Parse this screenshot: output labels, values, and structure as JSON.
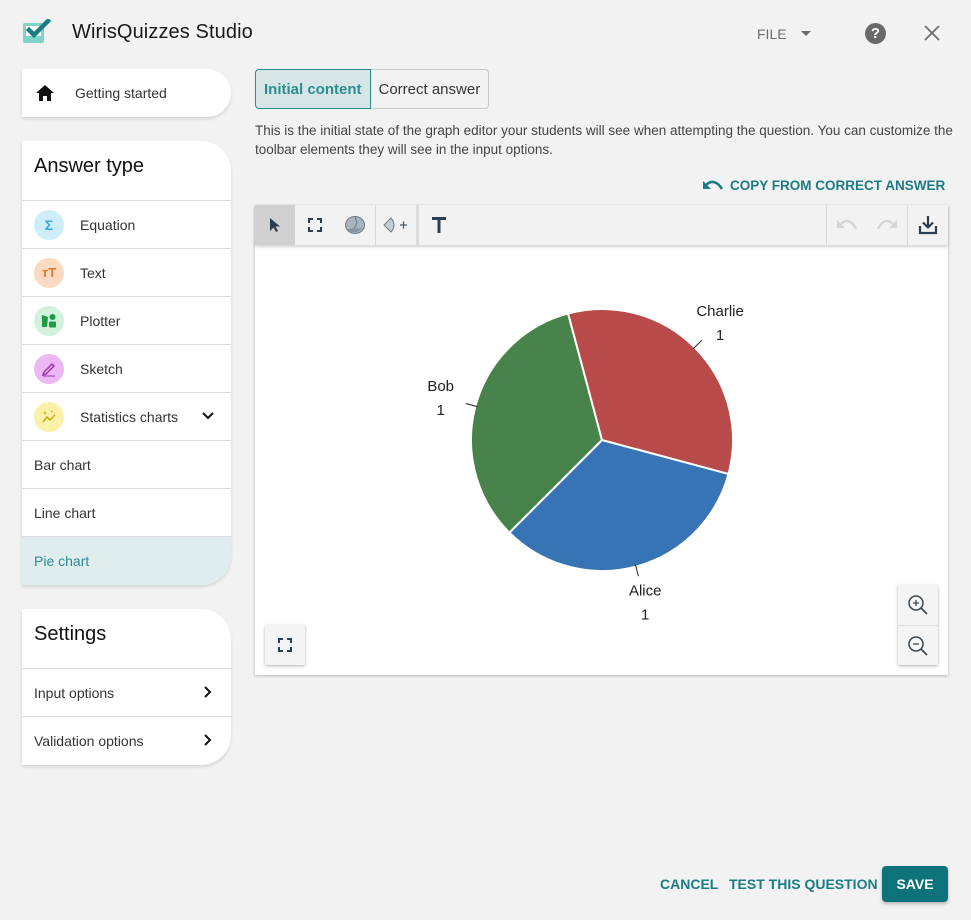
{
  "header": {
    "app_title": "WirisQuizzes Studio",
    "file_menu": "FILE",
    "help_icon": "help-icon",
    "close_icon": "close-icon"
  },
  "sidebar": {
    "getting_started": "Getting started",
    "answer_type": {
      "title": "Answer type",
      "items": [
        {
          "label": "Equation",
          "icon": "sigma-icon",
          "icon_bg": "#cdeef9",
          "icon_color": "#3aa6d6",
          "glyph": "Σ"
        },
        {
          "label": "Text",
          "icon": "text-size-icon",
          "icon_bg": "#fcd9c1",
          "icon_color": "#e8772a",
          "glyph": "тT"
        },
        {
          "label": "Plotter",
          "icon": "shapes-icon",
          "icon_bg": "#d3f1dd",
          "icon_color": "#1e9a45",
          "glyph": ""
        },
        {
          "label": "Sketch",
          "icon": "pencil-icon",
          "icon_bg": "#ecb8f4",
          "icon_color": "#a233b8",
          "glyph": ""
        },
        {
          "label": "Statistics charts",
          "icon": "sparkle-chart-icon",
          "icon_bg": "#fbf1a8",
          "icon_color": "#c8a812",
          "glyph": ""
        }
      ],
      "sub_items": [
        {
          "label": "Bar chart",
          "selected": false
        },
        {
          "label": "Line chart",
          "selected": false
        },
        {
          "label": "Pie chart",
          "selected": true
        }
      ]
    },
    "settings": {
      "title": "Settings",
      "items": [
        {
          "label": "Input options"
        },
        {
          "label": "Validation options"
        }
      ]
    }
  },
  "main": {
    "tabs": [
      {
        "label": "Initial content",
        "active": true
      },
      {
        "label": "Correct answer",
        "active": false
      }
    ],
    "description": "This is the initial state of the graph editor your students will see when attempting the question. You can customize the toolbar elements they will see in the input options.",
    "copy_link": "COPY FROM CORRECT ANSWER",
    "toolbar": {
      "tools": [
        "select-arrow-icon",
        "fit-view-icon",
        "pie-slice-icon",
        "add-sector-icon",
        "text-tool-icon"
      ],
      "right_tools": [
        "undo-icon",
        "redo-icon",
        "download-icon"
      ]
    }
  },
  "chart_data": {
    "type": "pie",
    "title": "",
    "labels": [
      "Alice",
      "Bob",
      "Charlie"
    ],
    "values": [
      1,
      1,
      1
    ],
    "colors": [
      "#3774b6",
      "#47834b",
      "#b94a4a"
    ],
    "start_angle_deg": 111,
    "direction": "counterclockwise-from-alice",
    "show_values": true
  },
  "footer": {
    "cancel": "CANCEL",
    "test": "TEST THIS QUESTION",
    "save": "SAVE"
  },
  "colors": {
    "accent": "#1b7c84",
    "save_bg": "#0e727a",
    "selected_row_bg": "#e0edee",
    "page_bg": "#f2f2f2"
  }
}
